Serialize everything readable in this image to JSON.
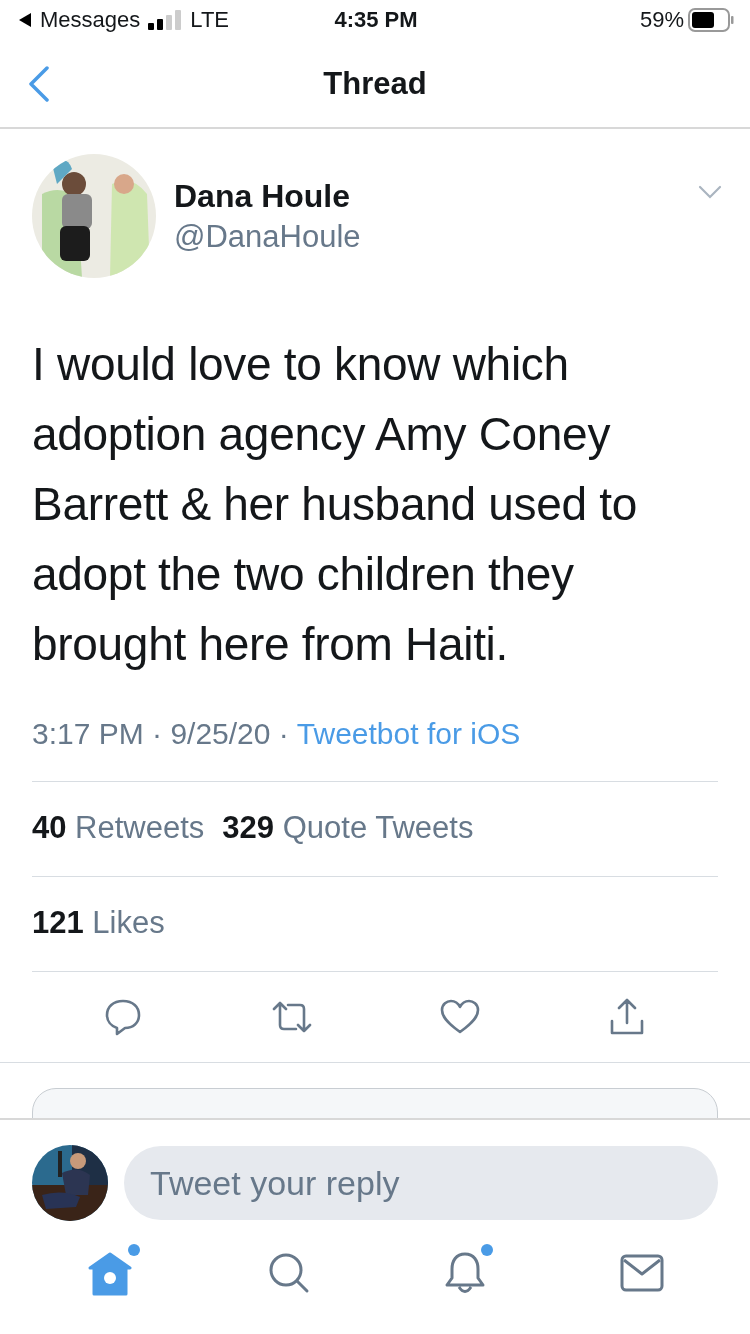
{
  "status_bar": {
    "back_label": "Messages",
    "network": "LTE",
    "time": "4:35 PM",
    "battery": "59%"
  },
  "nav": {
    "title": "Thread"
  },
  "tweet": {
    "author": {
      "name": "Dana Houle",
      "handle": "@DanaHoule"
    },
    "text": "I would love to know which adoption agency Amy Coney Barrett & her husband used to adopt the two children they brought here from Haiti.",
    "time": "3:17 PM",
    "date": "9/25/20",
    "separator": "·",
    "client": "Tweetbot for iOS",
    "stats": [
      {
        "count": "40",
        "label": "Retweets"
      },
      {
        "count": "329",
        "label": "Quote Tweets"
      }
    ],
    "likes": {
      "count": "121",
      "label": "Likes"
    },
    "actions": [
      {
        "kind": "reply"
      },
      {
        "kind": "retweet"
      },
      {
        "kind": "like"
      },
      {
        "kind": "share"
      }
    ]
  },
  "reply_bar": {
    "placeholder": "Tweet your reply"
  },
  "tab_bar": [
    {
      "kind": "home",
      "selected": true,
      "badge": true
    },
    {
      "kind": "search",
      "selected": false,
      "badge": false
    },
    {
      "kind": "notifications",
      "selected": false,
      "badge": true
    },
    {
      "kind": "messages",
      "selected": false,
      "badge": false
    }
  ]
}
